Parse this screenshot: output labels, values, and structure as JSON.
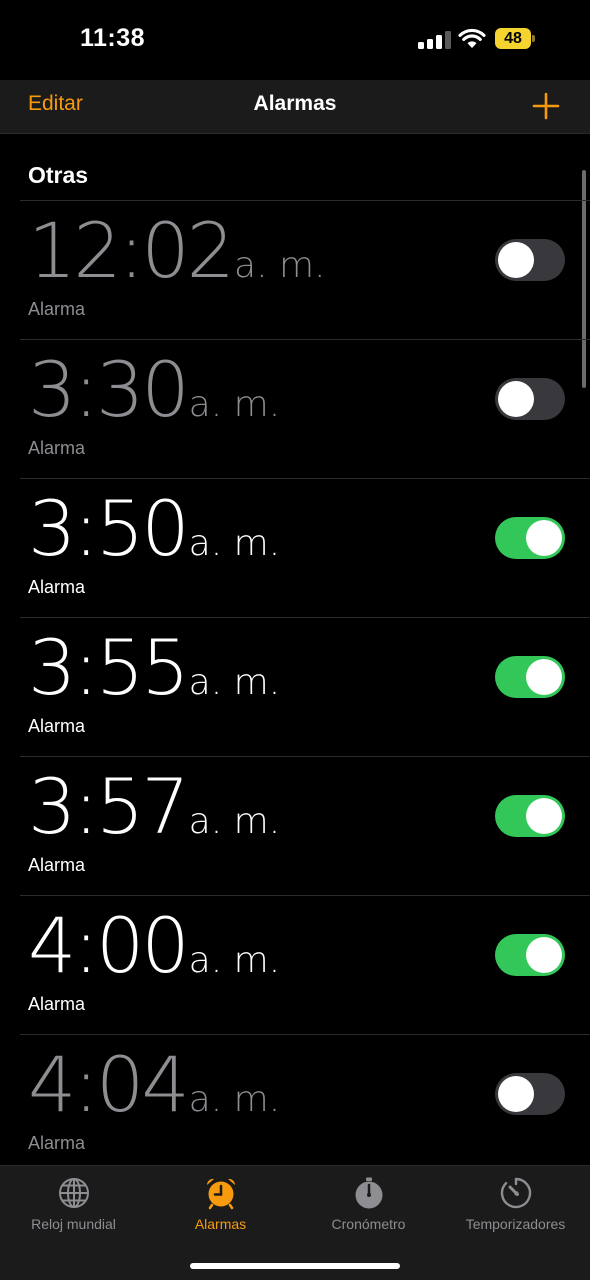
{
  "status_bar": {
    "time": "11:38",
    "battery_level": "48",
    "battery_color": "#f5d430",
    "signal_bars_active": 3,
    "signal_bars_total": 4
  },
  "nav": {
    "edit_label": "Editar",
    "title": "Alarmas",
    "add_icon": "plus-icon",
    "accent_color": "#f79a0d"
  },
  "section": {
    "title": "Otras"
  },
  "alarms": [
    {
      "time": "12:02",
      "ampm": "a. m.",
      "label": "Alarma",
      "enabled": false
    },
    {
      "time": "3:30",
      "ampm": "a. m.",
      "label": "Alarma",
      "enabled": false
    },
    {
      "time": "3:50",
      "ampm": "a. m.",
      "label": "Alarma",
      "enabled": true
    },
    {
      "time": "3:55",
      "ampm": "a. m.",
      "label": "Alarma",
      "enabled": true
    },
    {
      "time": "3:57",
      "ampm": "a. m.",
      "label": "Alarma",
      "enabled": true
    },
    {
      "time": "4:00",
      "ampm": "a. m.",
      "label": "Alarma",
      "enabled": true
    },
    {
      "time": "4:04",
      "ampm": "a. m.",
      "label": "Alarma",
      "enabled": false
    }
  ],
  "toggle_on_color": "#33c759",
  "tabs": [
    {
      "label": "Reloj mundial",
      "icon": "globe-icon",
      "active": false
    },
    {
      "label": "Alarmas",
      "icon": "alarm-clock-icon",
      "active": true
    },
    {
      "label": "Cronómetro",
      "icon": "stopwatch-icon",
      "active": false
    },
    {
      "label": "Temporizadores",
      "icon": "timer-icon",
      "active": false
    }
  ]
}
